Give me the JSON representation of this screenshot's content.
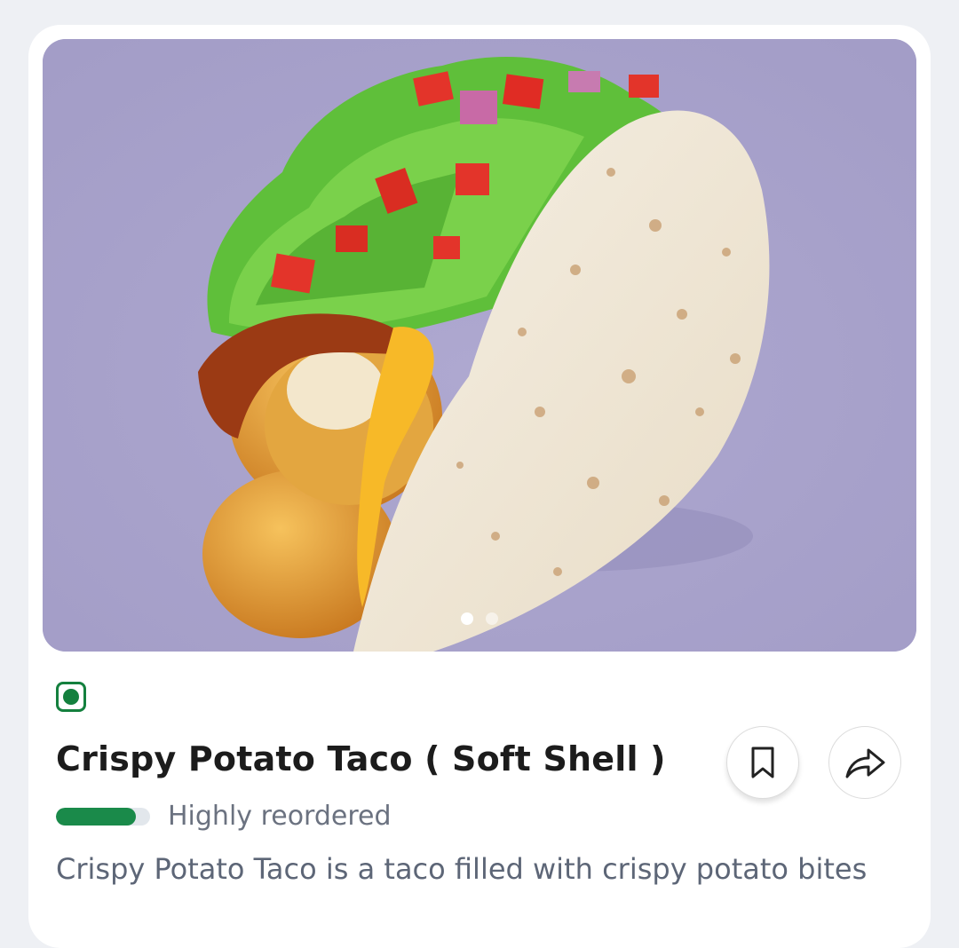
{
  "product": {
    "image": {
      "alt": "Crispy Potato Taco",
      "slide_count": 2,
      "active_slide": 0
    },
    "veg_indicator": "veg-icon",
    "title": "Crispy Potato Taco ( Soft Shell )",
    "reorder": {
      "label": "Highly reordered",
      "level": 0.85
    },
    "description": "Crispy Potato Taco is a taco filled with crispy potato bites"
  },
  "actions": {
    "bookmark": "bookmark-icon",
    "share": "share-icon"
  },
  "colors": {
    "background": "#a9a3cc",
    "veg_green": "#14803e",
    "reorder_green": "#1a8a4a"
  }
}
